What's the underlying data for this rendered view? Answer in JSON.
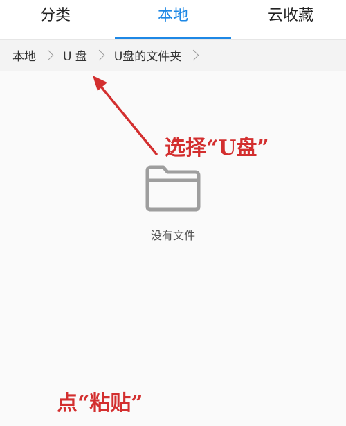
{
  "tabs": [
    {
      "label": "分类",
      "active": false
    },
    {
      "label": "本地",
      "active": true
    },
    {
      "label": "云收藏",
      "active": false
    }
  ],
  "breadcrumb": [
    "本地",
    "U 盘",
    "U盘的文件夹"
  ],
  "empty_state": {
    "icon": "folder-icon",
    "text": "没有文件"
  },
  "annotations": {
    "select_u": "选择“U盘”",
    "click_paste": "点“粘贴”"
  },
  "colors": {
    "accent": "#1e88e5",
    "annotation": "#d32f2f",
    "icon_gray": "#9e9e9e"
  }
}
